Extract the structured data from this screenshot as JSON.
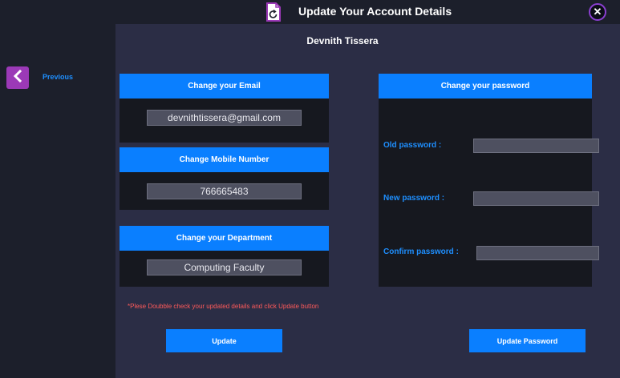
{
  "window": {
    "title": "Update Your Account Details",
    "title_icon": "document-refresh-icon",
    "close_icon": "close-icon"
  },
  "sidebar": {
    "previous_label": "Previous",
    "previous_icon": "chevron-left-icon"
  },
  "main": {
    "user_name": "Devnith Tissera",
    "email_card": {
      "header": "Change your Email",
      "value": "devnithtissera@gmail.com"
    },
    "mobile_card": {
      "header": "Change Mobile Number",
      "value": "766665483"
    },
    "department_card": {
      "header": "Change your Department",
      "value": "Computing Faculty"
    },
    "password_card": {
      "header": "Change your password",
      "old_label": "Old password :",
      "old_value": "",
      "new_label": "New password :",
      "new_value": "",
      "confirm_label": "Confirm password :",
      "confirm_value": ""
    },
    "note": "*Plese Doubble check your updated details and click Update button",
    "update_button": "Update",
    "update_password_button": "Update Password"
  },
  "colors": {
    "accent_blue": "#0a7fff",
    "purple": "#9b39b7",
    "background": "#2b2d45",
    "sidebar": "#1c1f2b",
    "warning_text": "#ff5a5a"
  }
}
